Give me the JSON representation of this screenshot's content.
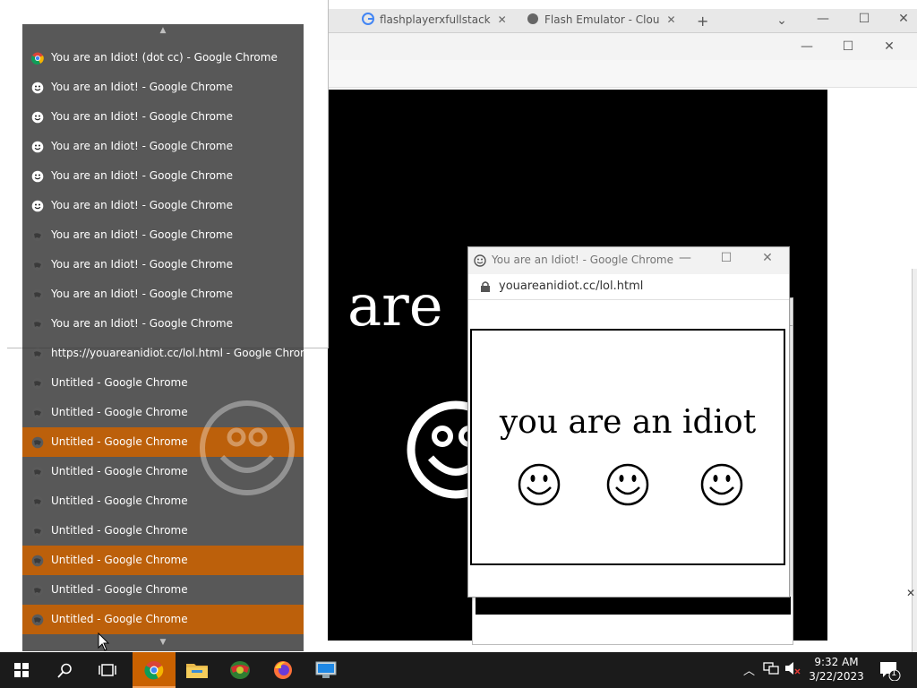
{
  "background_browser": {
    "tabs": [
      {
        "label": "flashplayerxfullstack",
        "icon": "google-g-icon"
      },
      {
        "label": "Flash Emulator - Clou",
        "icon": "globe-icon"
      }
    ],
    "new_tab_symbol": "+",
    "page_text_fragment": "are"
  },
  "popup": {
    "title": "You are an Idiot! - Google Chrome",
    "url": "youareanidiot.cc/lol.html",
    "message": "you are an idiot",
    "faces_count": 3
  },
  "switch_list": {
    "items": [
      {
        "label": "You are an Idiot! (dot cc) - Google Chrome",
        "icon": "chrome-icon",
        "selected": false
      },
      {
        "label": "You are an Idiot! - Google Chrome",
        "icon": "smiley-icon",
        "selected": false
      },
      {
        "label": "You are an Idiot! - Google Chrome",
        "icon": "smiley-icon",
        "selected": false
      },
      {
        "label": "You are an Idiot! - Google Chrome",
        "icon": "smiley-icon",
        "selected": false
      },
      {
        "label": "You are an Idiot! - Google Chrome",
        "icon": "smiley-icon",
        "selected": false
      },
      {
        "label": "You are an Idiot! - Google Chrome",
        "icon": "smiley-icon",
        "selected": false
      },
      {
        "label": "You are an Idiot! - Google Chrome",
        "icon": "globe-icon",
        "selected": false
      },
      {
        "label": "You are an Idiot! - Google Chrome",
        "icon": "globe-icon",
        "selected": false
      },
      {
        "label": "You are an Idiot! - Google Chrome",
        "icon": "globe-icon",
        "selected": false
      },
      {
        "label": "You are an Idiot! - Google Chrome",
        "icon": "globe-icon",
        "selected": false
      },
      {
        "label": "https://youareanidiot.cc/lol.html - Google Chrome",
        "icon": "globe-icon",
        "selected": false
      },
      {
        "label": "Untitled - Google Chrome",
        "icon": "globe-icon",
        "selected": false
      },
      {
        "label": "Untitled - Google Chrome",
        "icon": "globe-icon",
        "selected": false
      },
      {
        "label": "Untitled - Google Chrome",
        "icon": "globe-icon",
        "selected": true
      },
      {
        "label": "Untitled - Google Chrome",
        "icon": "globe-icon",
        "selected": false
      },
      {
        "label": "Untitled - Google Chrome",
        "icon": "globe-icon",
        "selected": false
      },
      {
        "label": "Untitled - Google Chrome",
        "icon": "globe-icon",
        "selected": false
      },
      {
        "label": "Untitled - Google Chrome",
        "icon": "globe-icon",
        "selected": true
      },
      {
        "label": "Untitled - Google Chrome",
        "icon": "globe-icon",
        "selected": false
      },
      {
        "label": "Untitled - Google Chrome",
        "icon": "globe-icon",
        "selected": true
      }
    ]
  },
  "taskbar": {
    "apps": [
      {
        "name": "start-button",
        "icon": "windows-icon"
      },
      {
        "name": "search-button",
        "icon": "search-icon"
      },
      {
        "name": "task-view-button",
        "icon": "task-view-icon"
      },
      {
        "name": "taskbar-chrome",
        "icon": "chrome-icon",
        "active": true
      },
      {
        "name": "taskbar-file-explorer",
        "icon": "folder-icon"
      },
      {
        "name": "taskbar-app-2",
        "icon": "colorful-globe-icon"
      },
      {
        "name": "taskbar-firefox",
        "icon": "firefox-icon"
      },
      {
        "name": "taskbar-app-4",
        "icon": "computer-icon"
      }
    ],
    "time": "9:32 AM",
    "date": "3/22/2023",
    "notification_count": "1"
  },
  "colors": {
    "accent_selected": "#c96100",
    "switch_list_bg": "#2e2e2e",
    "taskbar_bg": "#1b1b1b",
    "active_app_bg": "#c96100"
  }
}
